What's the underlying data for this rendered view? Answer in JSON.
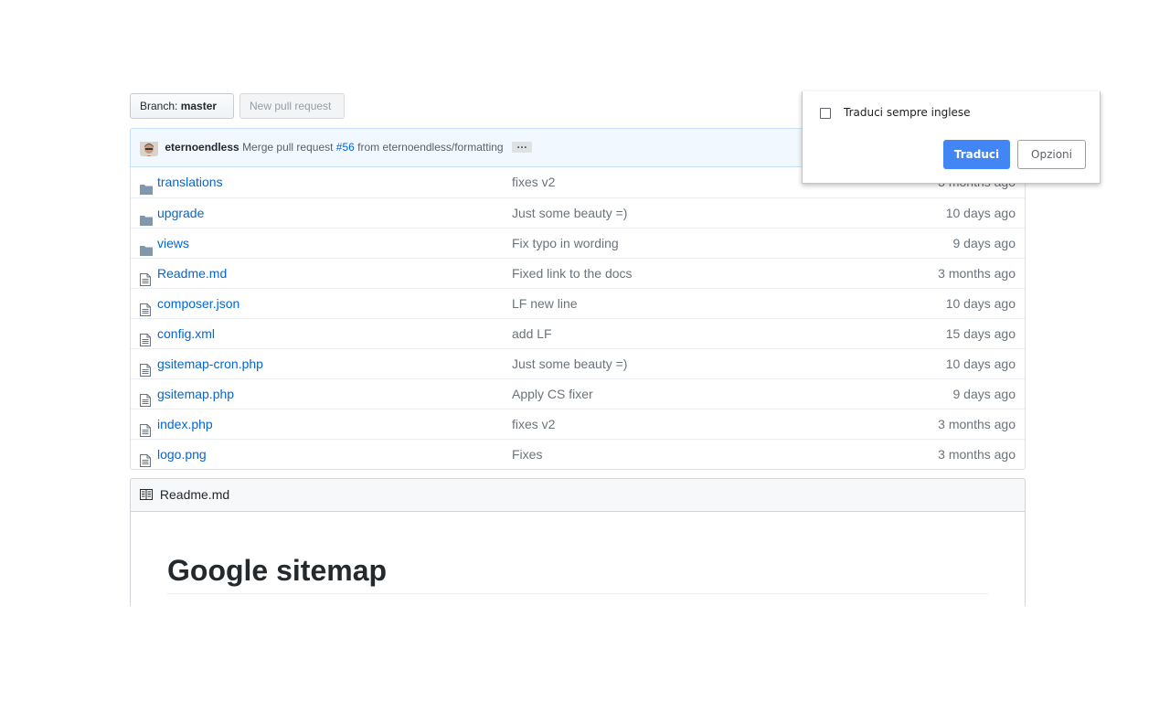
{
  "toolbar": {
    "branch_label": "Branch:",
    "branch_value": "master",
    "new_pr_label": "New pull request"
  },
  "commit": {
    "author": "eternoendless",
    "message_prefix": "Merge pull request",
    "pr_number": "#56",
    "message_suffix": "from eternoendless/formatting",
    "ellipsis": "…"
  },
  "files": [
    {
      "type": "folder",
      "name": "translations",
      "message": "fixes v2",
      "age": "3 months ago"
    },
    {
      "type": "folder",
      "name": "upgrade",
      "message": "Just some beauty =)",
      "age": "10 days ago"
    },
    {
      "type": "folder",
      "name": "views",
      "message": "Fix typo in wording",
      "age": "9 days ago"
    },
    {
      "type": "file",
      "name": "Readme.md",
      "message": "Fixed link to the docs",
      "age": "3 months ago"
    },
    {
      "type": "file",
      "name": "composer.json",
      "message": "LF new line",
      "age": "10 days ago"
    },
    {
      "type": "file",
      "name": "config.xml",
      "message": "add LF",
      "age": "15 days ago"
    },
    {
      "type": "file",
      "name": "gsitemap-cron.php",
      "message": "Just some beauty =)",
      "age": "10 days ago"
    },
    {
      "type": "file",
      "name": "gsitemap.php",
      "message": "Apply CS fixer",
      "age": "9 days ago"
    },
    {
      "type": "file",
      "name": "index.php",
      "message": "fixes v2",
      "age": "3 months ago"
    },
    {
      "type": "file",
      "name": "logo.png",
      "message": "Fixes",
      "age": "3 months ago"
    }
  ],
  "readme": {
    "header": "Readme.md",
    "title": "Google sitemap"
  },
  "translate_popup": {
    "always_translate_label": "Traduci sempre inglese",
    "always_translate_checked": false,
    "translate_button": "Traduci",
    "options_button": "Opzioni"
  },
  "colors": {
    "link": "#0366d6",
    "muted": "#6a737d",
    "commit_bg": "#f1f8ff",
    "translate_accent": "#4285f4"
  }
}
